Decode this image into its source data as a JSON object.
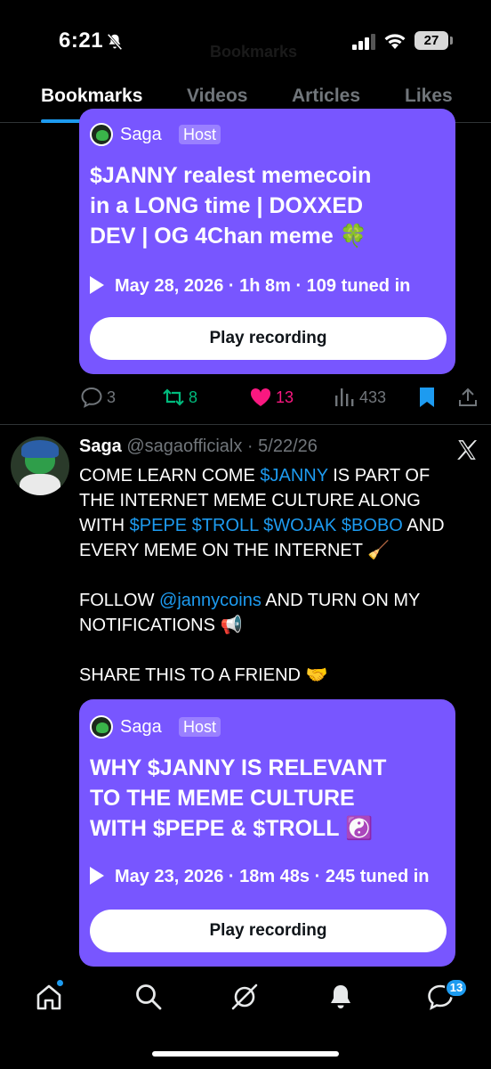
{
  "status_bar": {
    "time": "6:21",
    "ghost_title": "Bookmarks",
    "battery": "27"
  },
  "tabs": [
    {
      "label": "Bookmarks",
      "active": true
    },
    {
      "label": "Videos",
      "active": false
    },
    {
      "label": "Articles",
      "active": false
    },
    {
      "label": "Likes",
      "active": false
    }
  ],
  "first_space": {
    "host_name": "Saga",
    "host_badge": "Host",
    "title_lines": [
      "$JANNY realest memecoin",
      "in a LONG time | DOXXED",
      "DEV | OG 4Chan meme 🍀"
    ],
    "meta": "May 28, 2026 · 1h 8m · 109 tuned in",
    "button": "Play recording"
  },
  "actions": {
    "replies": "3",
    "reposts": "8",
    "likes": "13",
    "views": "433",
    "colors": {
      "repost": "#00ba7c",
      "like": "#f91880",
      "bookmark": "#1d9bf0",
      "muted": "#71767b"
    }
  },
  "post": {
    "name": "Saga",
    "handle": "@sagaofficialx · 5/22/26",
    "lines": [
      [
        {
          "t": "COME LEARN COME ",
          "link": false
        },
        {
          "t": "$JANNY",
          "link": true
        },
        {
          "t": " IS PART OF",
          "link": false
        }
      ],
      [
        {
          "t": "THE INTERNET MEME CULTURE ALONG",
          "link": false
        }
      ],
      [
        {
          "t": "WITH ",
          "link": false
        },
        {
          "t": "$PEPE",
          "link": true
        },
        {
          "t": " ",
          "link": false
        },
        {
          "t": "$TROLL",
          "link": true
        },
        {
          "t": " ",
          "link": false
        },
        {
          "t": "$WOJAK",
          "link": true
        },
        {
          "t": " ",
          "link": false
        },
        {
          "t": "$BOBO",
          "link": true
        },
        {
          "t": " AND",
          "link": false
        }
      ],
      [
        {
          "t": "EVERY MEME ON THE INTERNET 🧹",
          "link": false
        }
      ],
      [
        {
          "t": "",
          "link": false
        }
      ],
      [
        {
          "t": "FOLLOW ",
          "link": false
        },
        {
          "t": "@jannycoins",
          "link": true
        },
        {
          "t": " AND TURN ON MY",
          "link": false
        }
      ],
      [
        {
          "t": "NOTIFICATIONS 📢",
          "link": false
        }
      ],
      [
        {
          "t": "",
          "link": false
        }
      ],
      [
        {
          "t": "SHARE THIS TO A FRIEND 🤝",
          "link": false
        }
      ]
    ]
  },
  "second_space": {
    "host_name": "Saga",
    "host_badge": "Host",
    "title_lines": [
      "WHY $JANNY IS RELEVANT",
      "TO THE MEME CULTURE",
      "WITH $PEPE & $TROLL ☯️"
    ],
    "meta": "May 23, 2026 · 18m 48s · 245 tuned in",
    "button": "Play recording"
  },
  "bottom_nav": {
    "items": [
      "home-icon",
      "search-icon",
      "grok-icon",
      "notifications-icon",
      "messages-icon"
    ],
    "messages_badge": "13"
  },
  "colors": {
    "space_card": "#7856ff",
    "link": "#1d9bf0",
    "accent": "#1d9bf0"
  }
}
